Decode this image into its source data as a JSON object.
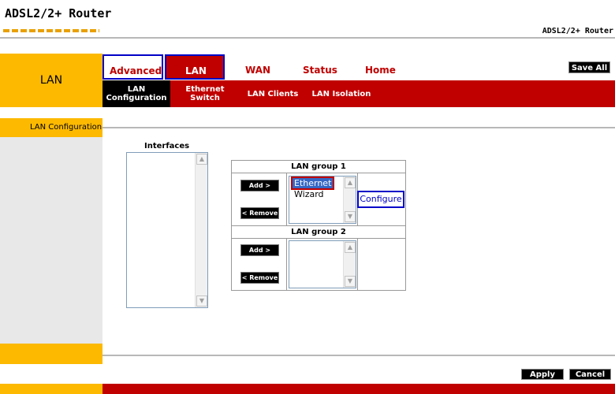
{
  "header": {
    "logo_text": "ADSL2/2+ Router",
    "brand_right": "ADSL2/2+ Router"
  },
  "sidebar": {
    "section_title": "LAN",
    "menu_item": "LAN Configuration"
  },
  "nav": {
    "tabs": [
      "Advanced",
      "LAN",
      "WAN",
      "Status",
      "Home"
    ],
    "save_all": "Save All"
  },
  "subnav": {
    "tabs": [
      {
        "line1": "LAN",
        "line2": "Configuration"
      },
      {
        "line1": "Ethernet",
        "line2": "Switch"
      },
      {
        "line1": "LAN Clients",
        "line2": ""
      },
      {
        "line1": "LAN Isolation",
        "line2": ""
      }
    ]
  },
  "interfaces": {
    "label": "Interfaces"
  },
  "lan_groups": [
    {
      "title": "LAN group 1",
      "add_label": "Add >",
      "remove_label": "< Remove",
      "items": [
        "Ethernet",
        "Wizard"
      ],
      "selected": "Ethernet",
      "configure_label": "Configure"
    },
    {
      "title": "LAN group 2",
      "add_label": "Add >",
      "remove_label": "< Remove",
      "items": []
    }
  ],
  "actions": {
    "apply": "Apply",
    "cancel": "Cancel"
  },
  "colors": {
    "accent_red": "#c00000",
    "accent_yellow": "#fcb900",
    "highlight_blue": "#0000c8",
    "selection_blue": "#3467c4"
  }
}
